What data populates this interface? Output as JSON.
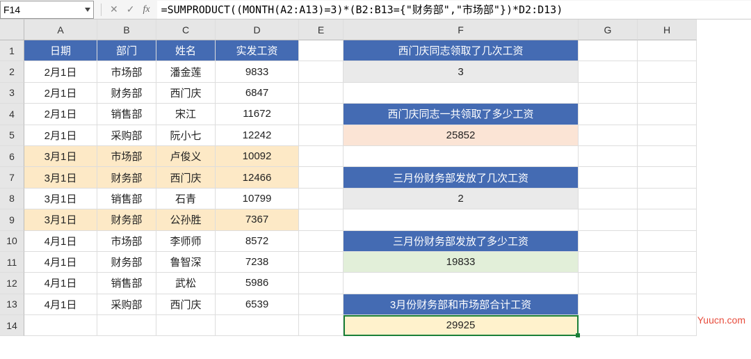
{
  "namebox": "F14",
  "fx_label": "fx",
  "formula": "=SUMPRODUCT((MONTH(A2:A13)=3)*(B2:B13={\"财务部\",\"市场部\"})*D2:D13)",
  "col_labels": [
    "A",
    "B",
    "C",
    "D",
    "E",
    "F",
    "G",
    "H"
  ],
  "rows": [
    "1",
    "2",
    "3",
    "4",
    "5",
    "6",
    "7",
    "8",
    "9",
    "10",
    "11",
    "12",
    "13",
    "14"
  ],
  "headers": {
    "A": "日期",
    "B": "部门",
    "C": "姓名",
    "D": "实发工资"
  },
  "data": [
    {
      "date": "2月1日",
      "dept": "市场部",
      "name": "潘金莲",
      "salary": "9833",
      "hl": false
    },
    {
      "date": "2月1日",
      "dept": "财务部",
      "name": "西门庆",
      "salary": "6847",
      "hl": false
    },
    {
      "date": "2月1日",
      "dept": "销售部",
      "name": "宋江",
      "salary": "11672",
      "hl": false
    },
    {
      "date": "2月1日",
      "dept": "采购部",
      "name": "阮小七",
      "salary": "12242",
      "hl": false
    },
    {
      "date": "3月1日",
      "dept": "市场部",
      "name": "卢俊义",
      "salary": "10092",
      "hl": true
    },
    {
      "date": "3月1日",
      "dept": "财务部",
      "name": "西门庆",
      "salary": "12466",
      "hl": true
    },
    {
      "date": "3月1日",
      "dept": "销售部",
      "name": "石青",
      "salary": "10799",
      "hl": false
    },
    {
      "date": "3月1日",
      "dept": "财务部",
      "name": "公孙胜",
      "salary": "7367",
      "hl": true
    },
    {
      "date": "4月1日",
      "dept": "市场部",
      "name": "李师师",
      "salary": "8572",
      "hl": false
    },
    {
      "date": "4月1日",
      "dept": "财务部",
      "name": "鲁智深",
      "salary": "7238",
      "hl": false
    },
    {
      "date": "4月1日",
      "dept": "销售部",
      "name": "武松",
      "salary": "5986",
      "hl": false
    },
    {
      "date": "4月1日",
      "dept": "采购部",
      "name": "西门庆",
      "salary": "6539",
      "hl": false
    }
  ],
  "fcol": {
    "1": {
      "text": "西门庆同志领取了几次工资",
      "cls": "hdrbig"
    },
    "2": {
      "text": "3",
      "cls": "gray"
    },
    "4": {
      "text": "西门庆同志一共领取了多少工资",
      "cls": "hdrbig"
    },
    "5": {
      "text": "25852",
      "cls": "peach"
    },
    "7": {
      "text": "三月份财务部发放了几次工资",
      "cls": "hdrbig"
    },
    "8": {
      "text": "2",
      "cls": "gray"
    },
    "10": {
      "text": "三月份财务部发放了多少工资",
      "cls": "hdrbig"
    },
    "11": {
      "text": "19833",
      "cls": "green"
    },
    "13": {
      "text": "3月份财务部和市场部合计工资",
      "cls": "hdrbig"
    },
    "14": {
      "text": "29925",
      "cls": "yellow active"
    }
  },
  "watermark": "Yuucn.com"
}
